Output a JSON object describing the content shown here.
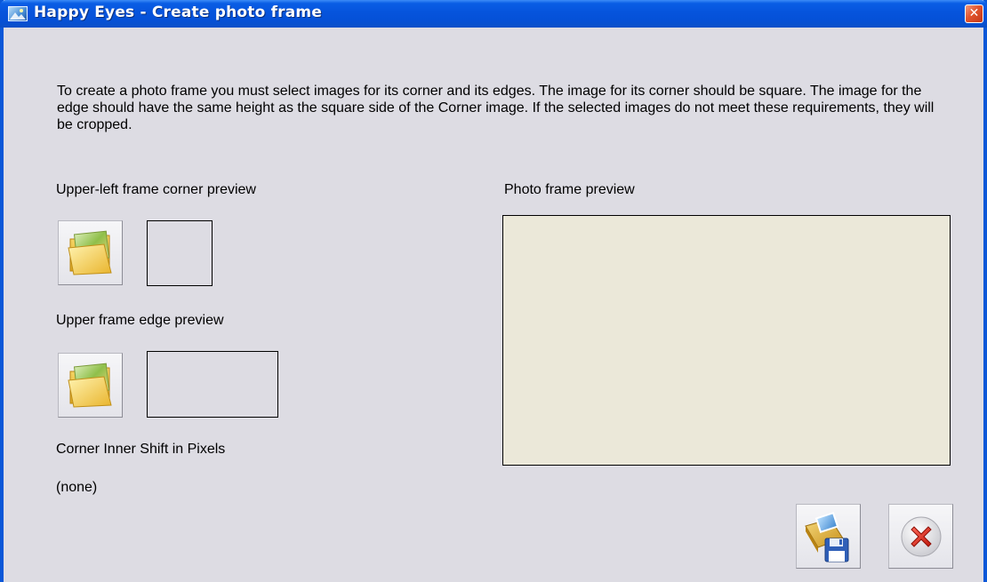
{
  "window": {
    "title": "Happy Eyes - Create photo frame",
    "close_glyph": "✕"
  },
  "intro_text": "To create a photo frame you must select images for its corner and its edges. The image for its corner should be square. The image for the edge should have the same height as the square side of the Corner image. If the selected images do not meet these requirements, they will be cropped.",
  "corner": {
    "label": "Upper-left frame corner preview",
    "open_icon": "folder-open-icon"
  },
  "edge": {
    "label": "Upper frame edge preview",
    "open_icon": "folder-open-icon"
  },
  "shift": {
    "label": "Corner Inner Shift in Pixels",
    "value": "(none)"
  },
  "preview": {
    "label": "Photo frame preview"
  },
  "actions": {
    "save_icon": "save-photo-icon",
    "cancel_icon": "cancel-x-icon"
  },
  "colors": {
    "titlebar": "#0654dc",
    "dialog_bg": "#dddce3",
    "preview_bg": "#ebe8d9",
    "close_red": "#e2532c"
  }
}
